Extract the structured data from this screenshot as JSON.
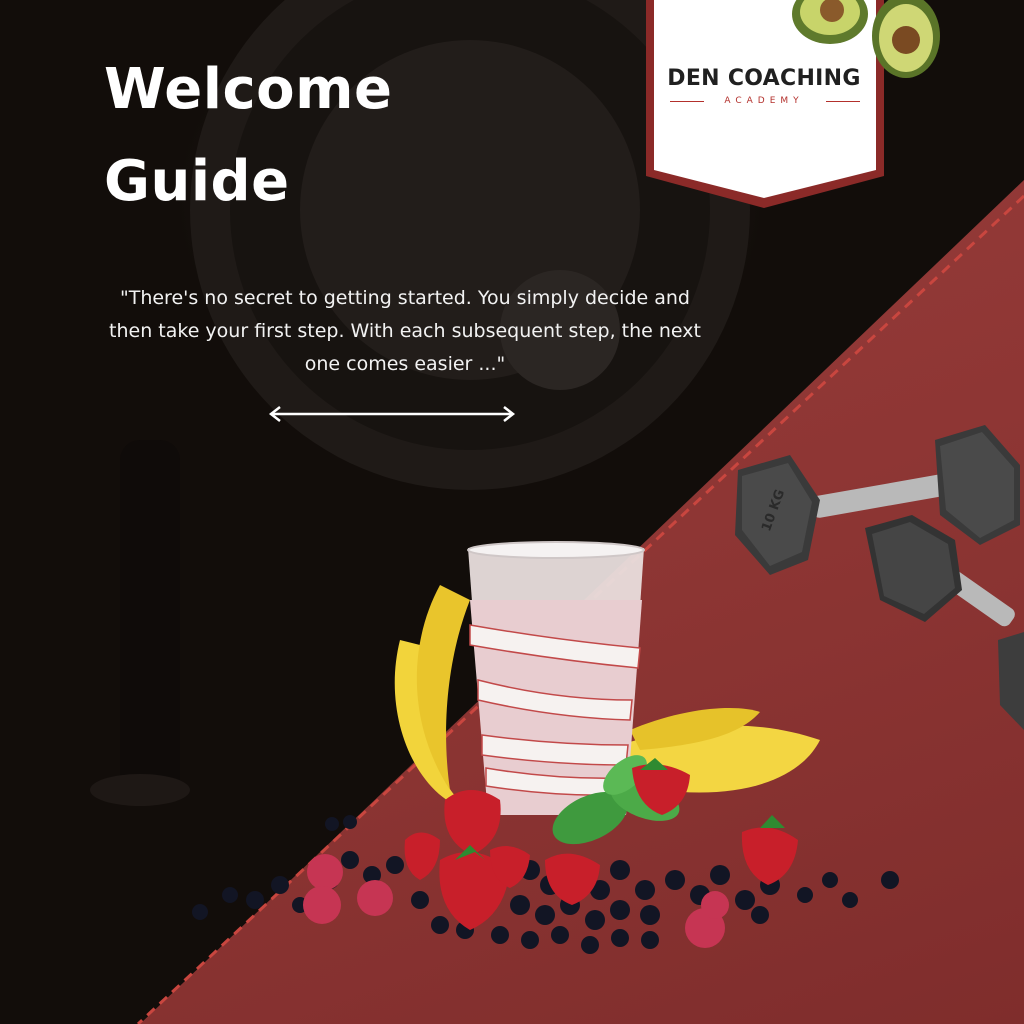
{
  "title": {
    "line1": "Welcome",
    "line2": "Guide"
  },
  "quote": {
    "text": "\"There's no secret to getting started. You simply decide and then take your first step. With each subsequent step, the next one comes easier ...\""
  },
  "brand": {
    "name": "DEN COACHING",
    "sub": "ACADEMY"
  },
  "dumbbells": {
    "weight_label": "10 KG"
  },
  "colors": {
    "accent_red": "#8e3634",
    "badge_border": "#8b2a28",
    "text_white": "#ffffff"
  },
  "icons": [
    "double-arrow-icon",
    "avocado-icon",
    "dumbbell-icon",
    "banana-icon",
    "strawberry-icon",
    "mint-leaf-icon"
  ]
}
